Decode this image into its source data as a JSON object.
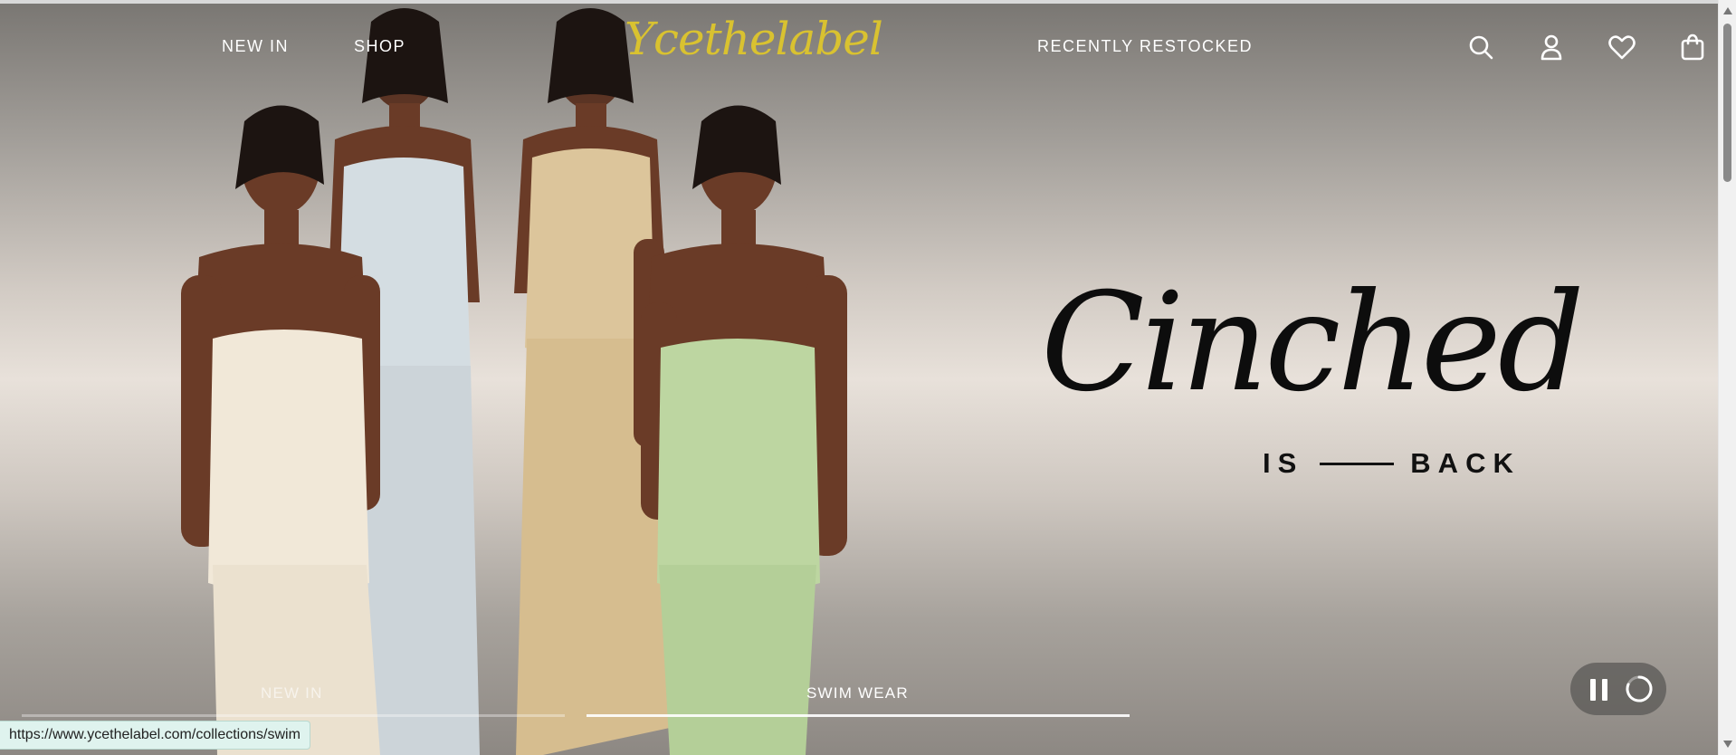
{
  "header": {
    "nav_left": [
      {
        "label": "NEW IN"
      },
      {
        "label": "SHOP"
      }
    ],
    "logo_text": "Ycethelabel",
    "nav_right": [
      {
        "label": "RECENTLY RESTOCKED"
      }
    ],
    "icons": [
      "search-icon",
      "account-icon",
      "wishlist-heart-icon",
      "cart-bag-icon"
    ]
  },
  "hero": {
    "headline_script": "Cinched",
    "headline_sub_left": "IS",
    "headline_sub_right": "BACK",
    "dress_colors": [
      "#efe6d6",
      "#cfd6db",
      "#d9c29a",
      "#b9d39c"
    ]
  },
  "slides": {
    "tabs": [
      {
        "label": "NEW IN",
        "active": false,
        "progress": 0
      },
      {
        "label": "SWIM WEAR",
        "active": true,
        "progress": 1
      }
    ]
  },
  "player": {
    "state": "playing",
    "control_icon": "pause-icon"
  },
  "status_bar": {
    "url": "https://www.ycethelabel.com/collections/swim"
  },
  "colors": {
    "logo": "#d9c230",
    "nav_text": "#ffffff",
    "headline": "#0d0d0d"
  }
}
